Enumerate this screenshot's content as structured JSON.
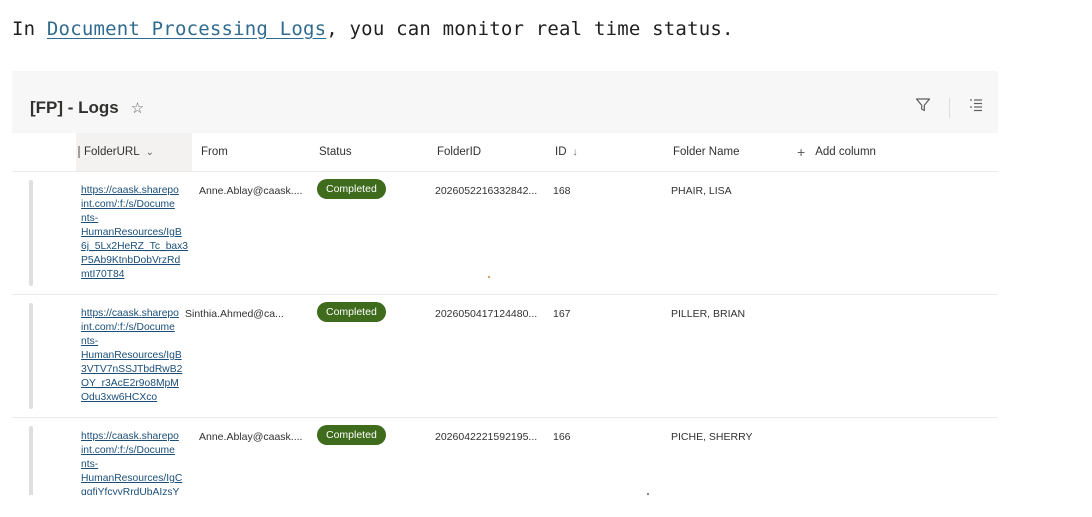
{
  "intro": {
    "prefix": "In ",
    "link": "Document Processing Logs",
    "suffix": ", you can monitor real time status."
  },
  "list": {
    "title": "[FP] - Logs",
    "star_glyph": "☆"
  },
  "columns": {
    "folderurl": "FolderURL",
    "from": "From",
    "status": "Status",
    "folderid": "FolderID",
    "id": "ID",
    "foldername": "Folder Name",
    "add": "Add column",
    "folderurl_arrow": "⌄",
    "id_arrow": "↓",
    "add_glyph": "+"
  },
  "rows": [
    {
      "url_lines": [
        "https://caask.sharepo",
        "int.com/:f:/s/Docume",
        "nts-",
        "HumanResources/IgB",
        "6j_5Lx2HeRZ_Tc_bax3",
        "P5Ab9KtnbDobVrzRd",
        "mtI70T84"
      ],
      "from": "Anne.Ablay@caask....",
      "status": "Completed",
      "folderid": "2026052216332842...",
      "id": "168",
      "foldername": "PHAIR, LISA"
    },
    {
      "url_lines": [
        "https://caask.sharepo",
        "int.com/:f:/s/Docume",
        "nts-",
        "HumanResources/IgB",
        "3VTV7nSSJTbdRwB2",
        "OY_r3AcE2r9o8MpM",
        "Odu3xw6HCXco"
      ],
      "from": "Sinthia.Ahmed@ca...",
      "status": "Completed",
      "folderid": "2026050417124480...",
      "id": "167",
      "foldername": "PILLER, BRIAN"
    },
    {
      "url_lines": [
        "https://caask.sharepo",
        "int.com/:f:/s/Docume",
        "nts-",
        "HumanResources/IgC",
        "qgfiYfcyyRrdUbAIzsY"
      ],
      "from": "Anne.Ablay@caask....",
      "status": "Completed",
      "folderid": "2026042221592195...",
      "id": "166",
      "foldername": "PICHE, SHERRY"
    }
  ],
  "colors": {
    "badge": "#3e6b1c",
    "link": "#1b4f7a",
    "intro_link": "#2f6b8f"
  },
  "icons": [
    "filter-icon",
    "view-options-icon"
  ]
}
